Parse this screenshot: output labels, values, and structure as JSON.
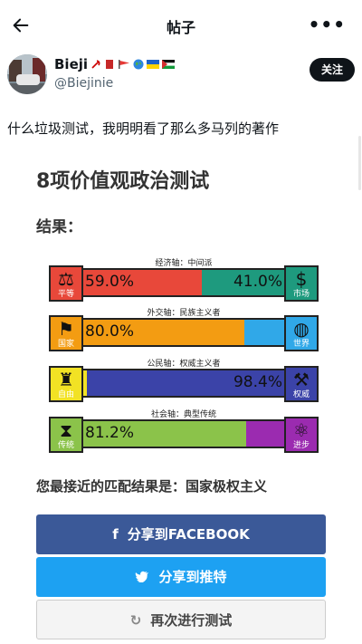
{
  "header": {
    "title": "帖子",
    "more_label": "•••"
  },
  "author": {
    "name": "Bieji",
    "handle": "@Biejinie",
    "follow_label": "关注"
  },
  "tweet": {
    "text": "什么垃圾测试，我明明看了那么多马列的著作"
  },
  "card": {
    "title": "8项价值观政治测试",
    "results_label": "结果：",
    "axes": [
      {
        "name": "经济轴：中间派",
        "left": {
          "label": "平等",
          "value": 59.0,
          "display": "59.0%",
          "color": "#e8483a",
          "icon": "scales-icon"
        },
        "right": {
          "label": "市场",
          "value": 41.0,
          "display": "41.0%",
          "color": "#1e9a7e",
          "icon": "dollar-icon"
        }
      },
      {
        "name": "外交轴：民族主义者",
        "left": {
          "label": "国家",
          "value": 80.0,
          "display": "80.0%",
          "color": "#f39c12",
          "icon": "flag-icon"
        },
        "right": {
          "label": "世界",
          "value": 20.0,
          "display": "",
          "color": "#30a8e8",
          "icon": "globe-icon"
        }
      },
      {
        "name": "公民轴：权威主义者",
        "left": {
          "label": "自由",
          "value": 1.6,
          "display": "",
          "color": "#f2e224",
          "icon": "liberty-icon"
        },
        "right": {
          "label": "权威",
          "value": 98.4,
          "display": "98.4%",
          "color": "#3b43a8",
          "icon": "gavel-icon"
        }
      },
      {
        "name": "社会轴：典型传统",
        "left": {
          "label": "传统",
          "value": 81.2,
          "display": "81.2%",
          "color": "#8bc34a",
          "icon": "hourglass-icon"
        },
        "right": {
          "label": "进步",
          "value": 18.8,
          "display": "",
          "color": "#9b2bb0",
          "icon": "atom-icon"
        }
      }
    ],
    "match_label": "您最接近的匹配结果是：国家极权主义",
    "buttons": {
      "facebook": "分享到FACEBOOK",
      "twitter": "分享到推特",
      "retake": "再次进行测试"
    }
  }
}
